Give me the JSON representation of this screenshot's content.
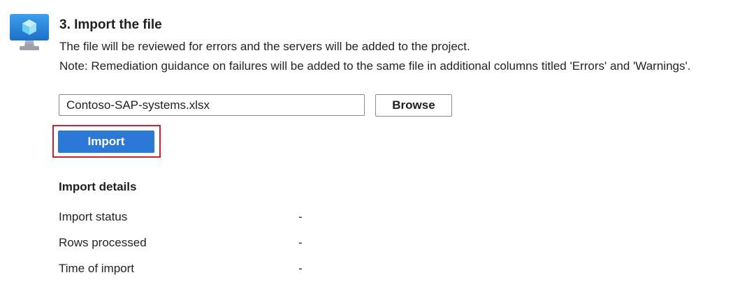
{
  "step": {
    "icon": "virtual-machine-icon",
    "title": "3. Import the file",
    "description": "The file will be reviewed for errors and the servers will be added to the project.",
    "note": "Note: Remediation guidance on failures will be added to the same file in additional columns titled 'Errors' and 'Warnings'."
  },
  "file_picker": {
    "value": "Contoso-SAP-systems.xlsx",
    "browse_label": "Browse"
  },
  "import_button": {
    "label": "Import",
    "highlight_color": "#d0202f",
    "color": "#2b78d6"
  },
  "details": {
    "heading": "Import details",
    "rows": [
      {
        "label": "Import status",
        "value": "-"
      },
      {
        "label": "Rows processed",
        "value": "-"
      },
      {
        "label": "Time of import",
        "value": "-"
      }
    ]
  }
}
